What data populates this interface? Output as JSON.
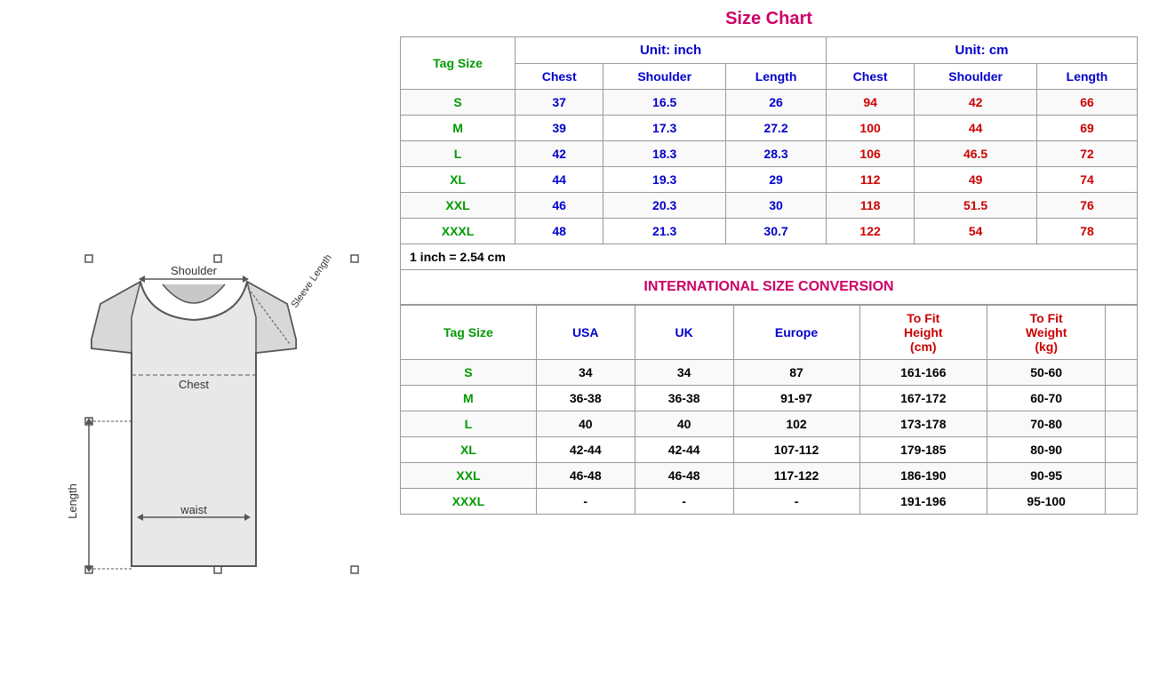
{
  "title": "Size Chart",
  "conversionTitle": "INTERNATIONAL SIZE CONVERSION",
  "inchNote": "1 inch = 2.54 cm",
  "unitInch": "Unit: inch",
  "unitCm": "Unit: cm",
  "tagSizeLabel": "Tag Size",
  "sizeHeaders": {
    "chest": "Chest",
    "shoulder": "Shoulder",
    "length": "Length"
  },
  "sizes": [
    {
      "tag": "S",
      "inch": {
        "chest": "37",
        "shoulder": "16.5",
        "length": "26"
      },
      "cm": {
        "chest": "94",
        "shoulder": "42",
        "length": "66"
      }
    },
    {
      "tag": "M",
      "inch": {
        "chest": "39",
        "shoulder": "17.3",
        "length": "27.2"
      },
      "cm": {
        "chest": "100",
        "shoulder": "44",
        "length": "69"
      }
    },
    {
      "tag": "L",
      "inch": {
        "chest": "42",
        "shoulder": "18.3",
        "length": "28.3"
      },
      "cm": {
        "chest": "106",
        "shoulder": "46.5",
        "length": "72"
      }
    },
    {
      "tag": "XL",
      "inch": {
        "chest": "44",
        "shoulder": "19.3",
        "length": "29"
      },
      "cm": {
        "chest": "112",
        "shoulder": "49",
        "length": "74"
      }
    },
    {
      "tag": "XXL",
      "inch": {
        "chest": "46",
        "shoulder": "20.3",
        "length": "30"
      },
      "cm": {
        "chest": "118",
        "shoulder": "51.5",
        "length": "76"
      }
    },
    {
      "tag": "XXXL",
      "inch": {
        "chest": "48",
        "shoulder": "21.3",
        "length": "30.7"
      },
      "cm": {
        "chest": "122",
        "shoulder": "54",
        "length": "78"
      }
    }
  ],
  "conversionHeaders": {
    "tagSize": "Tag Size",
    "usa": "USA",
    "uk": "UK",
    "europe": "Europe",
    "toFitHeight": "To Fit Height (cm)",
    "toFitWeight": "To Fit Weight (kg)"
  },
  "conversionSizes": [
    {
      "tag": "S",
      "usa": "34",
      "uk": "34",
      "europe": "87",
      "height": "161-166",
      "weight": "50-60"
    },
    {
      "tag": "M",
      "usa": "36-38",
      "uk": "36-38",
      "europe": "91-97",
      "height": "167-172",
      "weight": "60-70"
    },
    {
      "tag": "L",
      "usa": "40",
      "uk": "40",
      "europe": "102",
      "height": "173-178",
      "weight": "70-80"
    },
    {
      "tag": "XL",
      "usa": "42-44",
      "uk": "42-44",
      "europe": "107-112",
      "height": "179-185",
      "weight": "80-90"
    },
    {
      "tag": "XXL",
      "usa": "46-48",
      "uk": "46-48",
      "europe": "117-122",
      "height": "186-190",
      "weight": "90-95"
    },
    {
      "tag": "XXXL",
      "usa": "-",
      "uk": "-",
      "europe": "-",
      "height": "191-196",
      "weight": "95-100"
    }
  ]
}
